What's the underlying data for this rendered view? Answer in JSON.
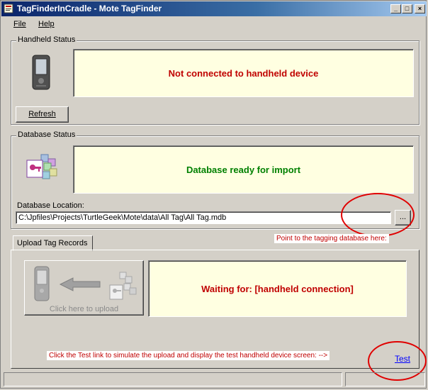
{
  "window": {
    "title": "TagFinderInCradle - Mote TagFinder",
    "controls": {
      "minimize": "_",
      "maximize": "□",
      "close": "×"
    }
  },
  "menu": {
    "file": "File",
    "help": "Help"
  },
  "handheld_status": {
    "group_label": "Handheld Status",
    "message": "Not connected to handheld device",
    "message_color": "#c00000",
    "refresh_label": "Refresh"
  },
  "database_status": {
    "group_label": "Database Status",
    "message": "Database ready for import",
    "message_color": "#008000",
    "location_label": "Database Location:",
    "location_value": "C:\\Jpfiles\\Projects\\TurtleGeek\\Mote\\data\\All Tag\\All Tag.mdb",
    "browse_label": "...",
    "hint": "Point to the tagging database here:"
  },
  "upload": {
    "tab_label": "Upload Tag Records",
    "upload_button_caption": "Click here to upload",
    "waiting_message": "Waiting for:  [handheld connection]",
    "test_hint": "Click the Test link to simulate the upload and display the test handheld device screen:  -->",
    "test_link": "Test"
  },
  "colors": {
    "annotation": "#e00000",
    "link": "#0000ff"
  }
}
